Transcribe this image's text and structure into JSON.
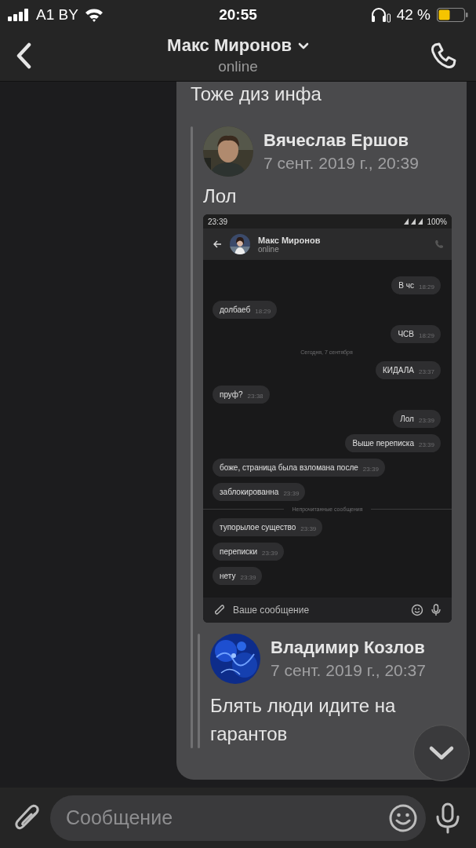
{
  "status_bar": {
    "carrier": "A1 BY",
    "time": "20:55",
    "battery": "42 %"
  },
  "header": {
    "title": "Макс Миронов",
    "subtitle": "online"
  },
  "message": {
    "text": "Тоже диз инфа",
    "forward": {
      "author": "Вячеслав Ершов",
      "date": "7 сент. 2019 г., 20:39",
      "text": "Лол",
      "screenshot": {
        "status_time": "23:39",
        "battery": "100%",
        "title": "Макс Миронов",
        "subtitle": "online",
        "messages": [
          {
            "kind": "out",
            "text": "В чс",
            "time": "18:29"
          },
          {
            "kind": "in",
            "text": "долбаеб",
            "time": "18:29"
          },
          {
            "kind": "out",
            "text": "ЧСВ",
            "time": "18:29"
          },
          {
            "kind": "date",
            "text": "Сегодня, 7 сентября"
          },
          {
            "kind": "out",
            "text": "КИДАЛА",
            "time": "23:37"
          },
          {
            "kind": "in",
            "text": "пруф?",
            "time": "23:38"
          },
          {
            "kind": "out",
            "text": "Лол",
            "time": "23:39"
          },
          {
            "kind": "out",
            "text": "Выше переписка",
            "time": "23:39"
          },
          {
            "kind": "in",
            "text": "боже, страница была взломана после",
            "time": "23:39"
          },
          {
            "kind": "in",
            "text": "заблокированна",
            "time": "23:39"
          },
          {
            "kind": "divider",
            "text": "Непрочитанные сообщения"
          },
          {
            "kind": "in",
            "text": "тупорылое существо",
            "time": "23:39"
          },
          {
            "kind": "in",
            "text": "переписки",
            "time": "23:39"
          },
          {
            "kind": "in",
            "text": "нету",
            "time": "23:39"
          }
        ],
        "input_placeholder": "Ваше сообщение"
      },
      "forward": {
        "author": "Владимир Козлов",
        "date": "7 сент. 2019 г., 20:37",
        "text": "Блять люди идите на гарантов"
      }
    }
  },
  "input": {
    "placeholder": "Сообщение"
  }
}
